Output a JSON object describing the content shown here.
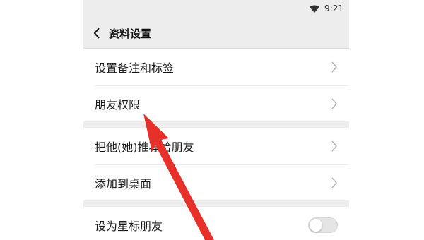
{
  "status_bar": {
    "time": "9:21",
    "wifi_icon": "wifi-icon"
  },
  "nav": {
    "back_icon": "chevron-left-icon",
    "title": "资料设置"
  },
  "items": [
    {
      "label": "设置备注和标签",
      "trailing": "chevron-right-icon"
    },
    {
      "label": "朋友权限",
      "trailing": "chevron-right-icon"
    },
    {
      "label": "把他(她)推荐给朋友",
      "trailing": "chevron-right-icon"
    },
    {
      "label": "添加到桌面",
      "trailing": "chevron-right-icon"
    },
    {
      "label": "设为星标朋友",
      "trailing": "toggle",
      "toggle_on": false
    }
  ],
  "colors": {
    "nav_background": "#ededed",
    "section_gap": "#ededed",
    "annotation_arrow": "#e8302a"
  }
}
